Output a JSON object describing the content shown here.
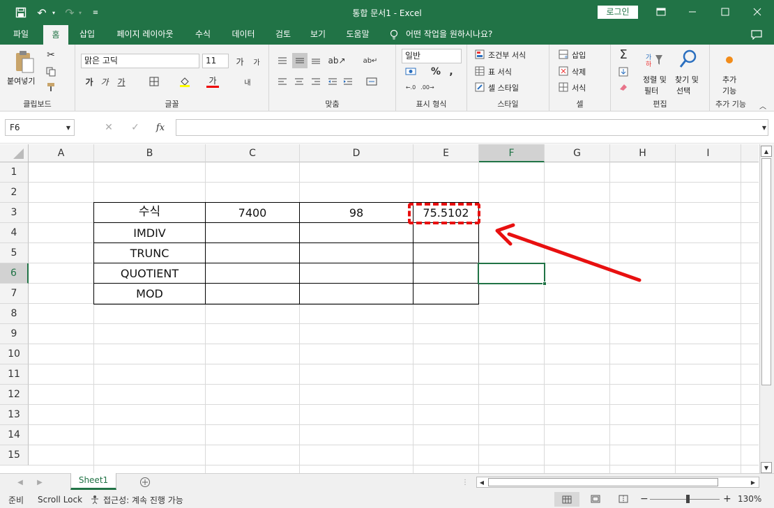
{
  "titlebar": {
    "title": "통합 문서1  -  Excel",
    "login": "로그인",
    "accent": "#217346"
  },
  "tabs": [
    "파일",
    "홈",
    "삽입",
    "페이지 레이아웃",
    "수식",
    "데이터",
    "검토",
    "보기",
    "도움말"
  ],
  "tell_me": "어떤 작업을 원하시나요?",
  "ribbon": {
    "clipboard": {
      "paste": "붙여넣기",
      "label": "클립보드"
    },
    "font": {
      "name": "맑은 고딕",
      "size": "11",
      "bold": "가",
      "italic": "가",
      "underline": "가",
      "label": "글꼴",
      "grow": "가",
      "shrink": "가",
      "color_a": "가",
      "wrap": "내"
    },
    "alignment": {
      "label": "맞춤"
    },
    "number": {
      "format": "일반",
      "percent": "%",
      "comma": ",",
      "label": "표시 형식"
    },
    "styles": {
      "conditional": "조건부 서식",
      "table": "표 서식",
      "cell": "셀 스타일",
      "label": "스타일"
    },
    "cells": {
      "insert": "삽입",
      "delete": "삭제",
      "format": "서식",
      "label": "셀"
    },
    "editing": {
      "sort": "정렬 및\n필터",
      "sort1": "정렬 및",
      "sort2": "필터",
      "find1": "찾기 및",
      "find2": "선택",
      "label": "편집"
    },
    "addins": {
      "a1": "추가",
      "a2": "기능",
      "label": "추가 기능"
    }
  },
  "formula_bar": {
    "cell_ref": "F6",
    "formula": ""
  },
  "columns": [
    "A",
    "B",
    "C",
    "D",
    "E",
    "F",
    "G",
    "H",
    "I"
  ],
  "rows": [
    "1",
    "2",
    "3",
    "4",
    "5",
    "6",
    "7",
    "8",
    "9",
    "10",
    "11",
    "12",
    "13",
    "14",
    "15"
  ],
  "selected_cell": "F6",
  "table": {
    "row3": [
      "수식",
      "7400",
      "98",
      "75.5102"
    ],
    "labels": [
      "IMDIV",
      "TRUNC",
      "QUOTIENT",
      "MOD"
    ]
  },
  "annotation_color": "#e81010",
  "sheet_tab": "Sheet1",
  "status": {
    "ready": "준비",
    "scroll_lock": "Scroll Lock",
    "accessibility": "접근성: 계속 진행 가능",
    "zoom": "130%"
  }
}
